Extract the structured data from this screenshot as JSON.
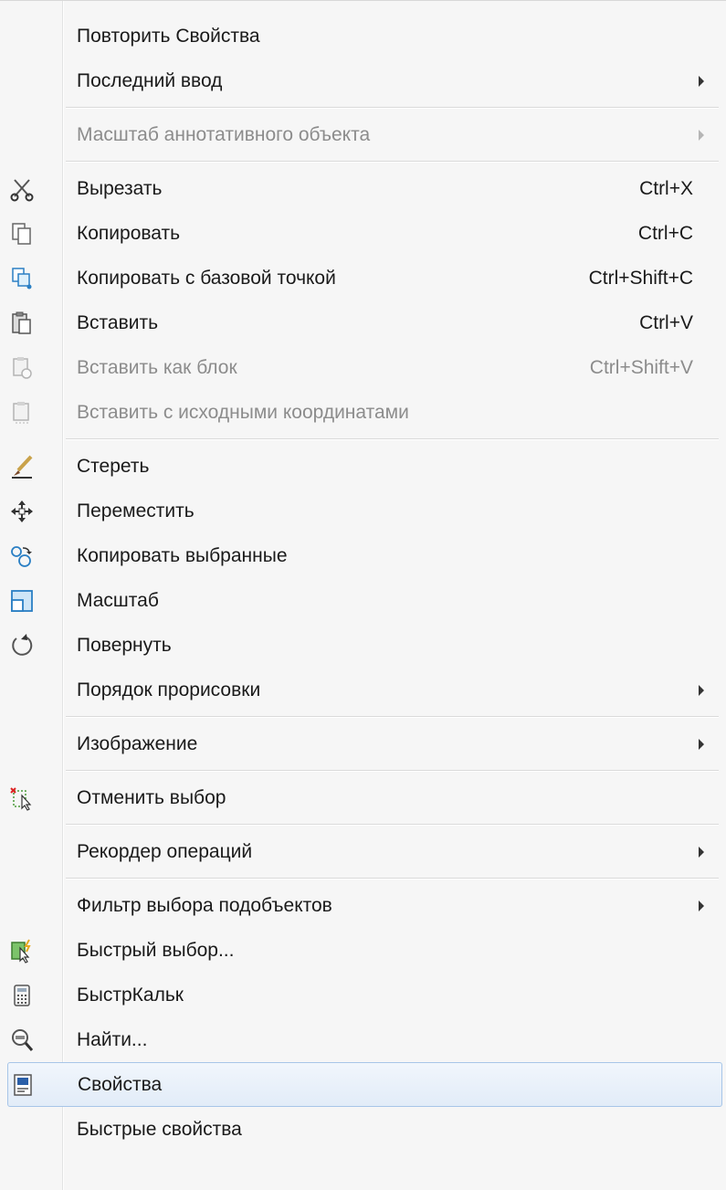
{
  "menu": {
    "items": [
      {
        "label": "Повторить Свойства"
      },
      {
        "label": "Последний ввод"
      },
      {
        "label": "Масштаб аннотативного объекта"
      },
      {
        "label": "Вырезать",
        "shortcut": "Ctrl+X",
        "icon": "cut-icon"
      },
      {
        "label": "Копировать",
        "shortcut": "Ctrl+C",
        "icon": "copy-icon"
      },
      {
        "label": "Копировать с базовой точкой",
        "shortcut": "Ctrl+Shift+C",
        "icon": "copy-base-point-icon"
      },
      {
        "label": "Вставить",
        "shortcut": "Ctrl+V",
        "icon": "paste-icon"
      },
      {
        "label": "Вставить как блок",
        "shortcut": "Ctrl+Shift+V",
        "icon": "paste-as-block-icon"
      },
      {
        "label": "Вставить с исходными координатами",
        "icon": "paste-original-coords-icon"
      },
      {
        "label": "Стереть",
        "icon": "erase-icon"
      },
      {
        "label": "Переместить",
        "icon": "move-icon"
      },
      {
        "label": "Копировать выбранные",
        "icon": "copy-selected-icon"
      },
      {
        "label": "Масштаб",
        "icon": "scale-icon"
      },
      {
        "label": "Повернуть",
        "icon": "rotate-icon"
      },
      {
        "label": "Порядок прорисовки"
      },
      {
        "label": "Изображение"
      },
      {
        "label": "Отменить выбор",
        "icon": "deselect-icon"
      },
      {
        "label": "Рекордер операций"
      },
      {
        "label": "Фильтр выбора подобъектов"
      },
      {
        "label": "Быстрый выбор...",
        "icon": "quick-select-icon"
      },
      {
        "label": "БыстрКальк",
        "icon": "calculator-icon"
      },
      {
        "label": "Найти...",
        "icon": "find-icon"
      },
      {
        "label": "Свойства",
        "icon": "properties-icon"
      },
      {
        "label": "Быстрые свойства"
      }
    ]
  },
  "colors": {
    "menu_background": "#f6f6f6",
    "text": "#1a1a1a",
    "disabled_text": "#8c8c8c",
    "highlight_border": "#a7c5e8",
    "highlight_fill": "#e2ecf8"
  }
}
